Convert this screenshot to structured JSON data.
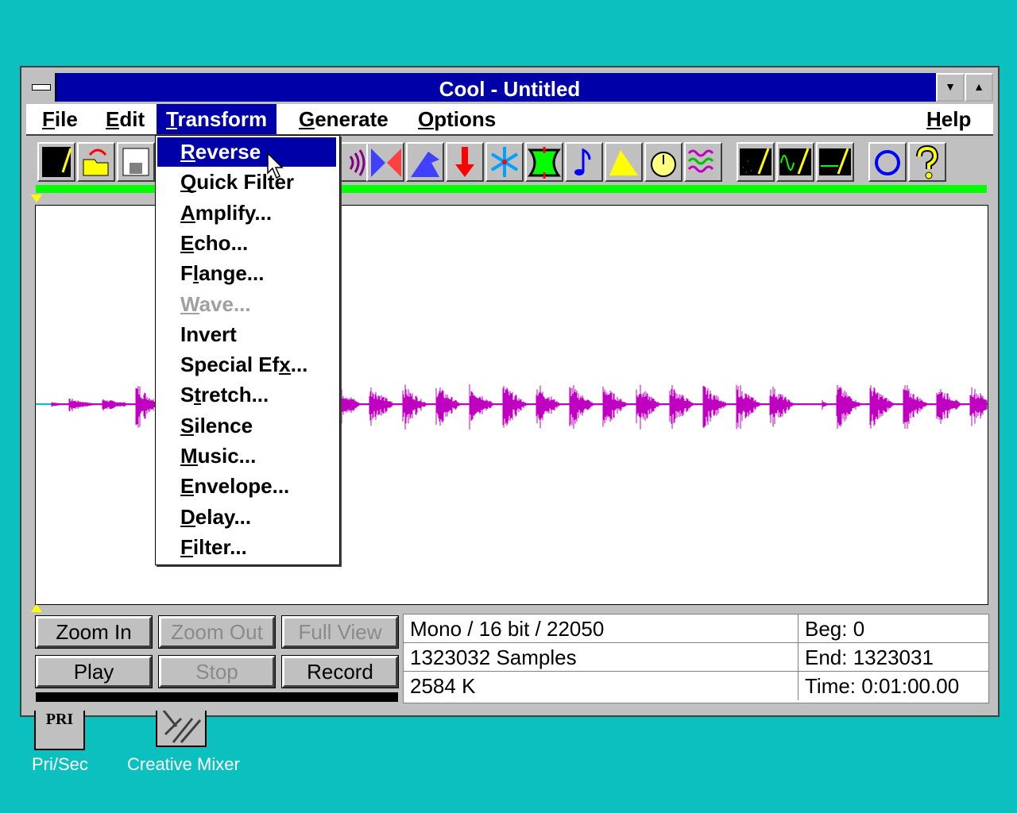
{
  "window": {
    "title": "Cool - Untitled"
  },
  "menubar": [
    {
      "label": "File",
      "ul": 0
    },
    {
      "label": "Edit",
      "ul": 0
    },
    {
      "label": "Transform",
      "ul": 0,
      "active": true
    },
    {
      "label": "Generate",
      "ul": 0
    },
    {
      "label": "Options",
      "ul": 0
    },
    {
      "label": "Help",
      "ul": 0
    }
  ],
  "transform_menu": [
    {
      "label": "Reverse",
      "ul": 0,
      "selected": true
    },
    {
      "label": "Quick Filter",
      "ul": 0
    },
    {
      "label": "Amplify...",
      "ul": 0
    },
    {
      "label": "Echo...",
      "ul": 0
    },
    {
      "label": "Flange...",
      "ul": 1
    },
    {
      "label": "Wave...",
      "ul": 0,
      "disabled": true
    },
    {
      "label": "Invert",
      "ul": -1
    },
    {
      "label": "Special Efx...",
      "ul": 10
    },
    {
      "label": "Stretch...",
      "ul": 1
    },
    {
      "label": "Silence",
      "ul": 0
    },
    {
      "label": "Music...",
      "ul": 0
    },
    {
      "label": "Envelope...",
      "ul": 0
    },
    {
      "label": "Delay...",
      "ul": 0
    },
    {
      "label": "Filter...",
      "ul": 0
    }
  ],
  "toolbar": [
    "new-icon",
    "open-icon",
    "save-icon",
    "echo-icon",
    "reverse-icon",
    "flange-icon",
    "amplify-down-icon",
    "freeze-icon",
    "stretch-icon",
    "music-icon",
    "envelope-icon",
    "timer-icon",
    "filter-icon",
    "noise-icon",
    "tone-icon",
    "silence-icon",
    "loop-icon",
    "help-icon"
  ],
  "buttons": {
    "zoom_in": "Zoom In",
    "zoom_out": "Zoom Out",
    "full_view": "Full View",
    "play": "Play",
    "stop": "Stop",
    "record": "Record"
  },
  "info": {
    "format": "Mono / 16 bit / 22050",
    "samples": "1323032 Samples",
    "size": "2584 K",
    "beg": "Beg: 0",
    "end": "End: 1323031",
    "time": "Time: 0:01:00.00"
  },
  "desktop": [
    {
      "label": "Pri/Sec",
      "glyph": "PRI"
    },
    {
      "label": "Creative Mixer"
    }
  ],
  "colors": {
    "desktop": "#0cc0c0",
    "titlebar": "#0000a8",
    "waveform": "#c000c0",
    "baseline": "#00c0c0",
    "progress": "#00ff00"
  }
}
